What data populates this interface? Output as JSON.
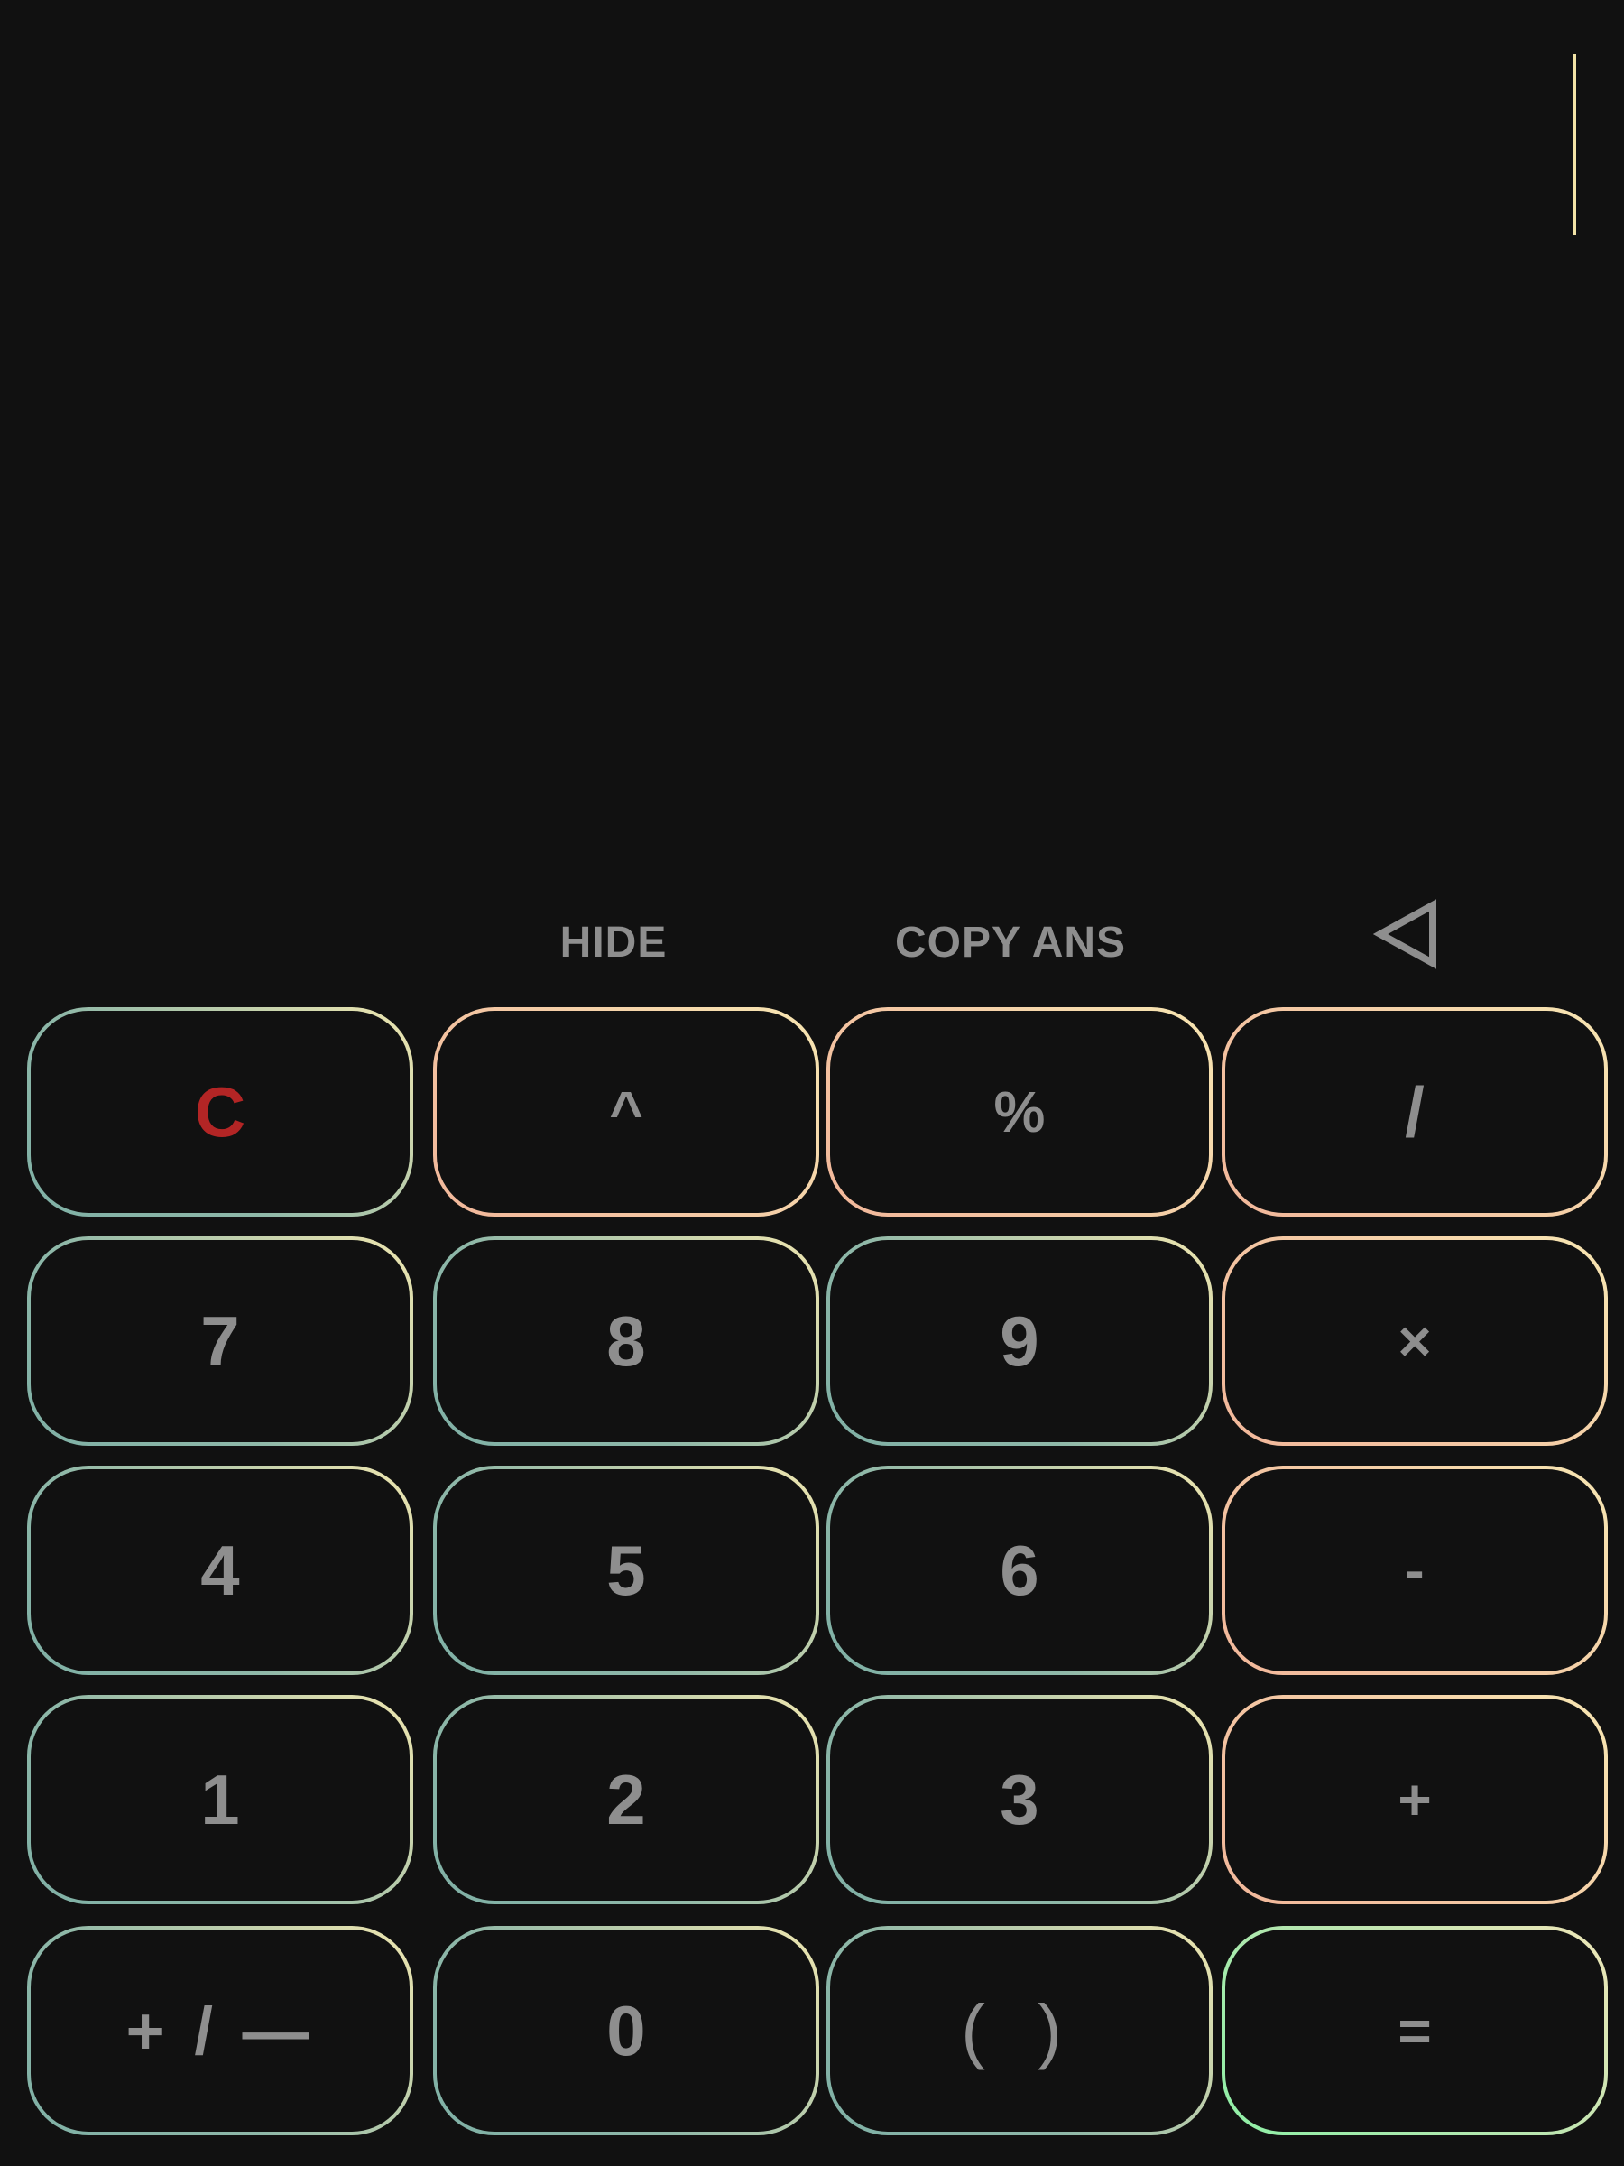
{
  "display": {
    "expression": ""
  },
  "toolbar": {
    "hide_label": "HIDE",
    "copy_ans_label": "COPY ANS"
  },
  "keys": {
    "clear": "C",
    "power": "^",
    "percent": "%",
    "divide": "/",
    "seven": "7",
    "eight": "8",
    "nine": "9",
    "multiply": "×",
    "four": "4",
    "five": "5",
    "six": "6",
    "minus": "-",
    "one": "1",
    "two": "2",
    "three": "3",
    "plus": "+",
    "plus_minus": "+ / —",
    "zero": "0",
    "parentheses": "( )",
    "equals": "="
  },
  "colors": {
    "background": "#111111",
    "key_text": "#8e8e8e",
    "clear_text": "#b32525",
    "cursor": "#f2e3a6"
  }
}
